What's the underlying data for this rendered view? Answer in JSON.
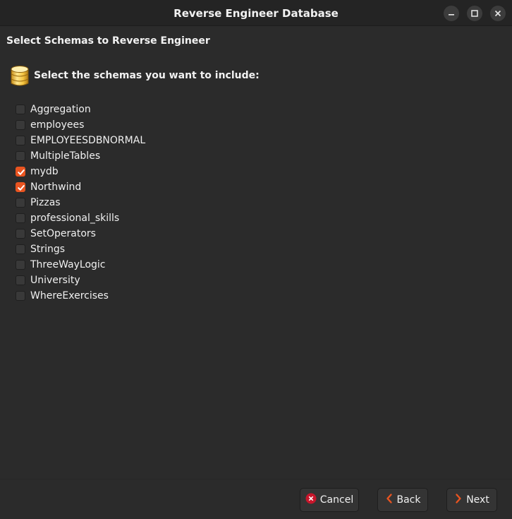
{
  "window": {
    "title": "Reverse Engineer Database"
  },
  "page": {
    "heading": "Select Schemas to Reverse Engineer",
    "subheading": "Select the schemas you want to include:"
  },
  "schemas": [
    {
      "label": "Aggregation",
      "checked": false
    },
    {
      "label": "employees",
      "checked": false
    },
    {
      "label": "EMPLOYEESDBNORMAL",
      "checked": false
    },
    {
      "label": "MultipleTables",
      "checked": false
    },
    {
      "label": "mydb",
      "checked": true
    },
    {
      "label": "Northwind",
      "checked": true
    },
    {
      "label": "Pizzas",
      "checked": false
    },
    {
      "label": "professional_skills",
      "checked": false
    },
    {
      "label": "SetOperators",
      "checked": false
    },
    {
      "label": "Strings",
      "checked": false
    },
    {
      "label": "ThreeWayLogic",
      "checked": false
    },
    {
      "label": "University",
      "checked": false
    },
    {
      "label": "WhereExercises",
      "checked": false
    }
  ],
  "buttons": {
    "cancel_label": "Cancel",
    "back_label": "Back",
    "next_label": "Next"
  },
  "colors": {
    "accent": "#e95420",
    "cancel_icon": "#c7162b",
    "database_icon": "#f5c542"
  },
  "icons": {
    "section": "database-icon",
    "cancel": "cancel-icon",
    "back": "chevron-left-icon",
    "next": "chevron-right-icon"
  }
}
